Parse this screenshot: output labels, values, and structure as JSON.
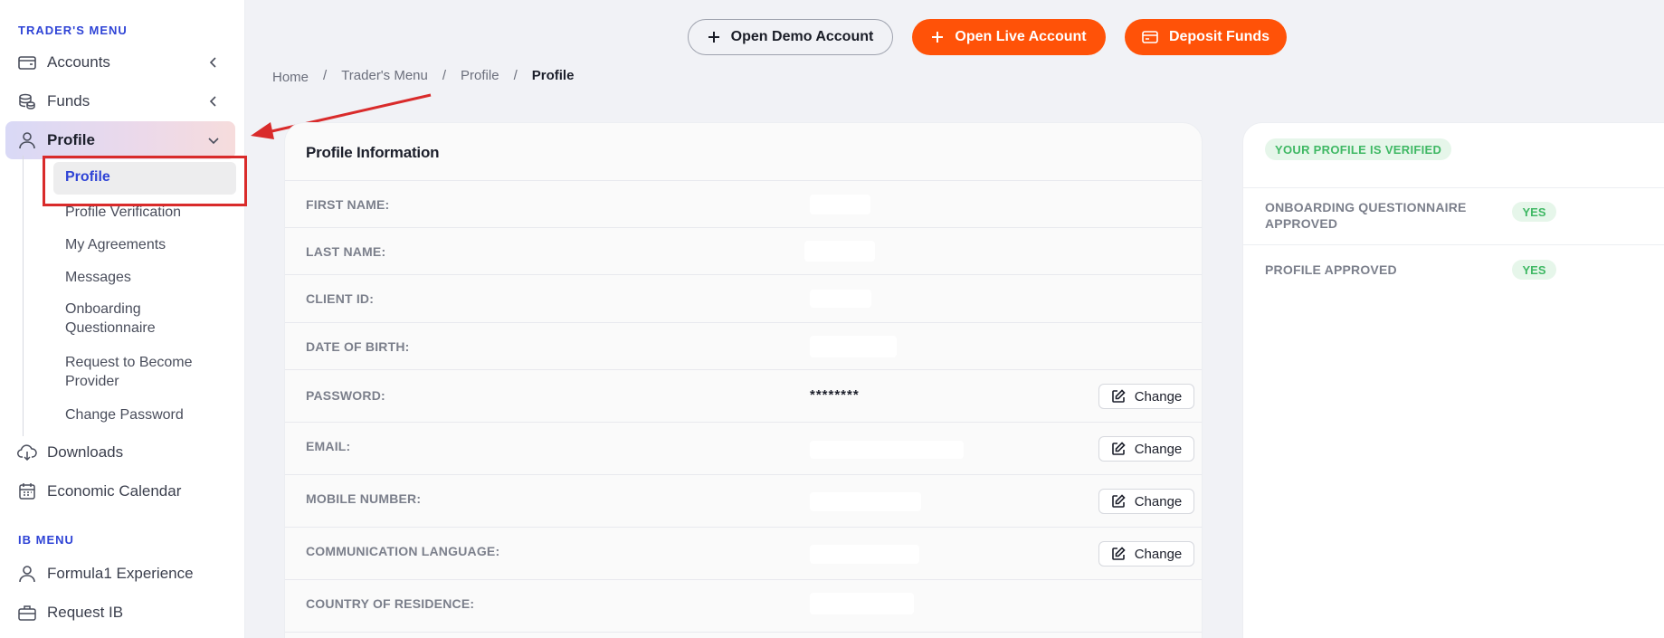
{
  "sidebar": {
    "traders_menu_title": "TRADER'S MENU",
    "ib_menu_title": "IB MENU",
    "items": {
      "accounts": "Accounts",
      "funds": "Funds",
      "profile": "Profile",
      "downloads": "Downloads",
      "economic_calendar": "Economic Calendar",
      "formula1": "Formula1 Experience",
      "request_ib": "Request IB"
    },
    "profile_sub": {
      "profile": "Profile",
      "verification": "Profile Verification",
      "agreements": "My Agreements",
      "messages": "Messages",
      "onboarding_1": "Onboarding",
      "onboarding_2": "Questionnaire",
      "provider_1": "Request to Become",
      "provider_2": "Provider",
      "change_password": "Change Password"
    }
  },
  "topbar": {
    "demo_label": "Open Demo Account",
    "live_label": "Open Live Account",
    "deposit_label": "Deposit Funds"
  },
  "breadcrumb": {
    "home": "Home",
    "traders_menu": "Trader's Menu",
    "profile": "Profile",
    "current": "Profile",
    "separator": "/"
  },
  "profile_card": {
    "title": "Profile Information",
    "labels": {
      "first_name": "FIRST NAME:",
      "last_name": "LAST NAME:",
      "client_id": "CLIENT ID:",
      "dob": "DATE OF BIRTH:",
      "password": "PASSWORD:",
      "email": "EMAIL:",
      "mobile": "MOBILE NUMBER:",
      "language": "COMMUNICATION LANGUAGE:",
      "country": "COUNTRY OF RESIDENCE:"
    },
    "password_value": "********",
    "change_label": "Change"
  },
  "status_panel": {
    "verified_badge": "YOUR PROFILE IS VERIFIED",
    "onboarding_1": "ONBOARDING QUESTIONNAIRE",
    "onboarding_2": "APPROVED",
    "onboarding_value": "YES",
    "profile_approved": "PROFILE APPROVED",
    "profile_value": "YES"
  },
  "colors": {
    "accent_orange": "#ff5208",
    "menu_blue": "#2f44d6",
    "verified_green": "#3fb864",
    "annotation_red": "#d92b2b"
  }
}
